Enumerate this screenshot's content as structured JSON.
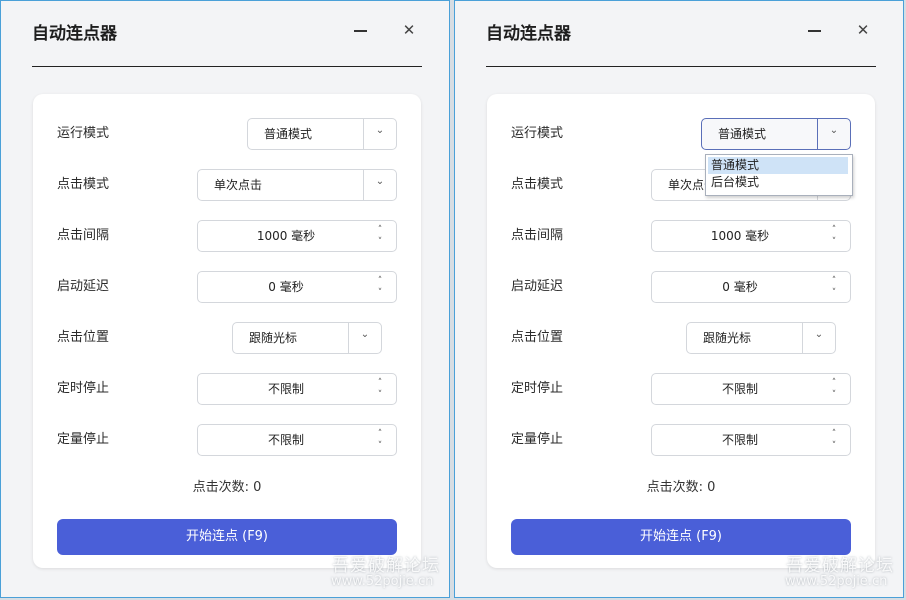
{
  "app": {
    "title": "自动连点器"
  },
  "window_controls": {
    "minimize": "—",
    "close": "✕"
  },
  "labels": {
    "run_mode": "运行模式",
    "click_mode": "点击模式",
    "click_interval": "点击间隔",
    "start_delay": "启动延迟",
    "click_position": "点击位置",
    "timed_stop": "定时停止",
    "count_stop": "定量停止"
  },
  "values": {
    "run_mode": "普通模式",
    "click_mode": "单次点击",
    "click_interval": "1000  毫秒",
    "start_delay": "0  毫秒",
    "click_position": "跟随光标",
    "timed_stop": "不限制",
    "count_stop": "不限制"
  },
  "click_count": "点击次数: 0",
  "start_button": "开始连点 (F9)",
  "run_mode_dropdown": {
    "options": [
      "普通模式",
      "后台模式"
    ],
    "highlighted": "普通模式"
  },
  "watermark": {
    "line1": "吾爱破解论坛",
    "line2": "www.52pojie.cn"
  },
  "icons": {
    "spin_up": "˄",
    "spin_down": "˅"
  }
}
